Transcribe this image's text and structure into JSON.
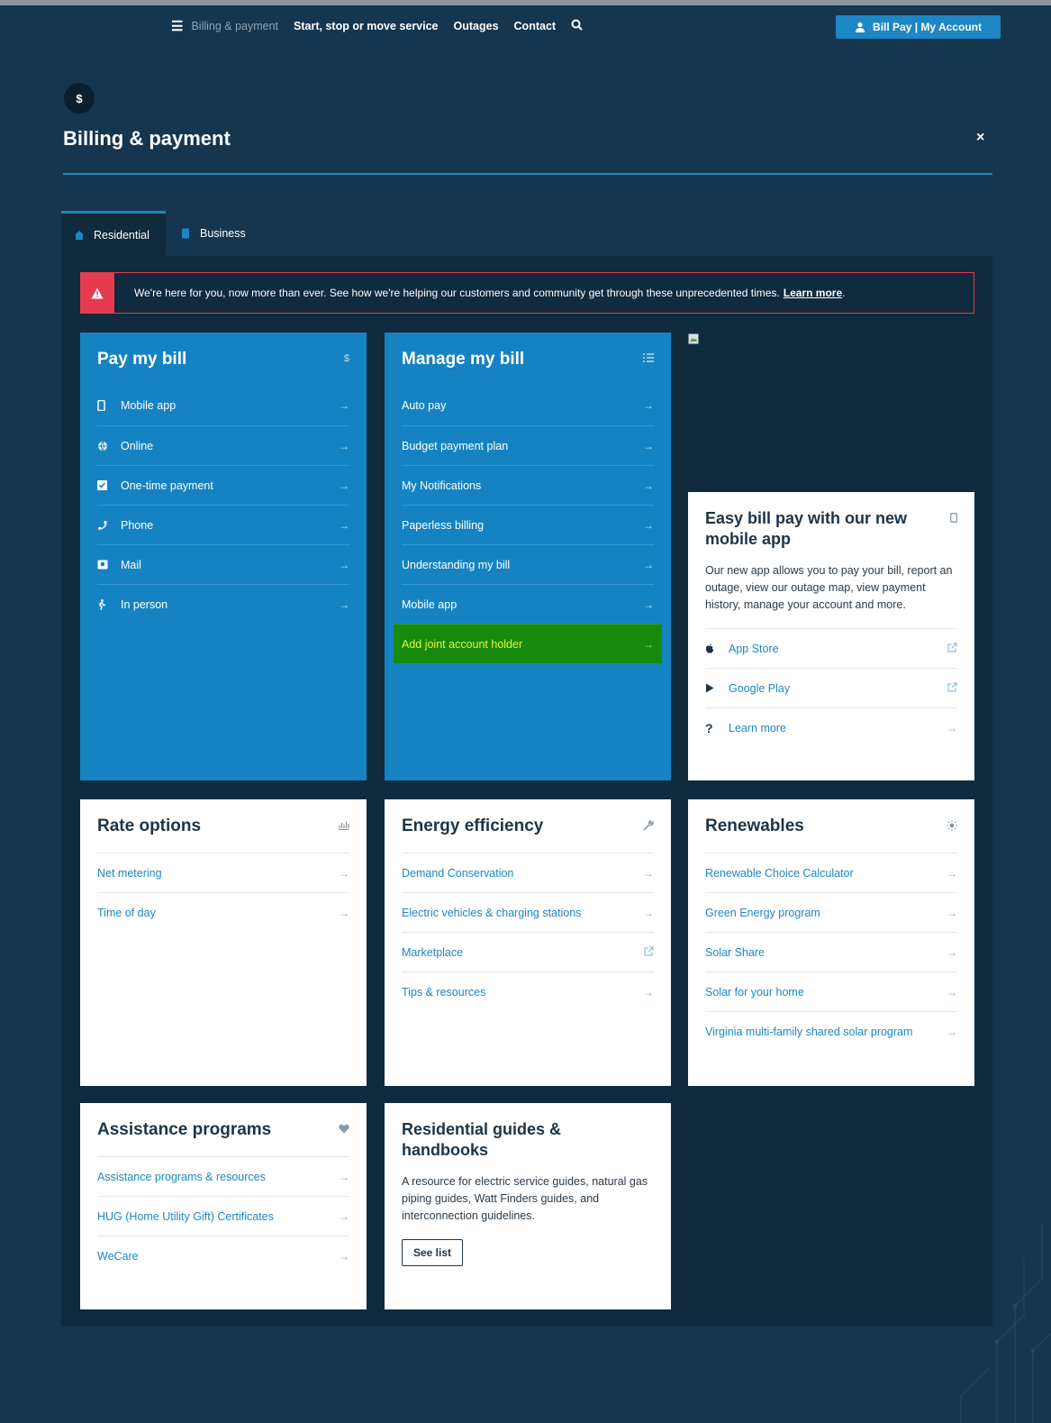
{
  "nav": {
    "items": [
      "Billing & payment",
      "Start, stop or move service",
      "Outages",
      "Contact"
    ],
    "bill_pay": "Bill Pay | My Account"
  },
  "header": {
    "icon_text": "$",
    "title": "Billing & payment",
    "close": "×"
  },
  "tabs": [
    "Residential",
    "Business"
  ],
  "alert": {
    "text": "We're here for you, now more than ever. See how we're helping our customers and community get through these unprecedented times.",
    "link": "Learn more",
    "after": "."
  },
  "pay": {
    "title": "Pay my bill",
    "icon": "$",
    "items": [
      "Mobile app",
      "Online",
      "One-time payment",
      "Phone",
      "Mail",
      "In person"
    ]
  },
  "manage": {
    "title": "Manage my bill",
    "items": [
      "Auto pay",
      "Budget payment plan",
      "My Notifications",
      "Paperless billing",
      "Understanding my bill",
      "Mobile app",
      "Add joint account holder"
    ]
  },
  "app": {
    "title": "Easy bill pay with our new mobile app",
    "desc": "Our new app allows you to pay your bill, report an outage, view our outage map, view payment history, manage your account and more.",
    "items": [
      "App Store",
      "Google Play",
      "Learn more"
    ],
    "learn_icon": "?"
  },
  "rate": {
    "title": "Rate options",
    "items": [
      "Net metering",
      "Time of day"
    ]
  },
  "energy": {
    "title": "Energy efficiency",
    "items": [
      "Demand Conservation",
      "Electric vehicles & charging stations",
      "Marketplace",
      "Tips & resources"
    ]
  },
  "renew": {
    "title": "Renewables",
    "items": [
      "Renewable Choice Calculator",
      "Green Energy program",
      "Solar Share",
      "Solar for your home",
      "Virginia multi-family shared solar program"
    ]
  },
  "assist": {
    "title": "Assistance programs",
    "items": [
      "Assistance programs & resources",
      "HUG (Home Utility Gift) Certificates",
      "WeCare"
    ]
  },
  "guides": {
    "title": "Residential guides & handbooks",
    "desc": "A resource for electric service guides, natural gas piping guides, Watt Finders guides, and interconnection guidelines.",
    "button": "See list"
  },
  "colors": {
    "background": "#16354e",
    "panel": "#102a3e",
    "accent_blue": "#1583c2",
    "alert_red": "#e63a4f",
    "highlight_green": "#178a0e",
    "highlight_text": "#e3f53b"
  }
}
